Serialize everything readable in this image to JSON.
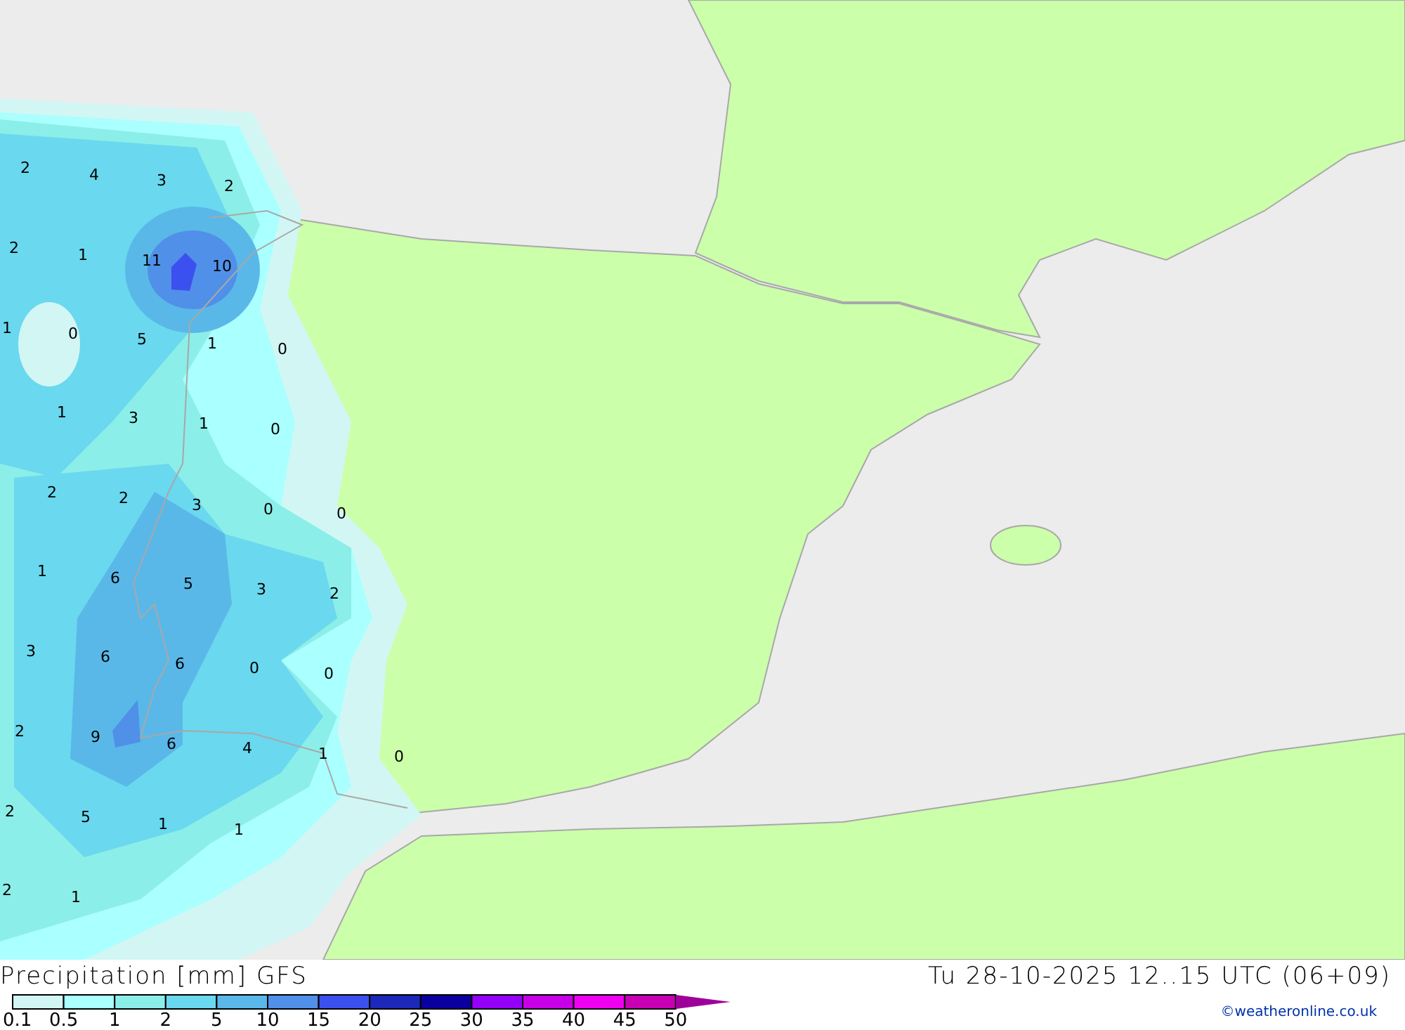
{
  "map": {
    "values": [
      "2",
      "4",
      "3",
      "2",
      "2",
      "1",
      "11",
      "10",
      "1",
      "0",
      "5",
      "1",
      "0",
      "1",
      "3",
      "1",
      "0",
      "2",
      "2",
      "3",
      "0",
      "0",
      "1",
      "6",
      "5",
      "3",
      "2",
      "3",
      "6",
      "6",
      "0",
      "0",
      "2",
      "9",
      "6",
      "4",
      "1",
      "0",
      "2",
      "5",
      "1",
      "1",
      "2",
      "1"
    ]
  },
  "title": "Precipitation [mm] GFS",
  "valid_time": "Tu 28-10-2025 12..15 UTC (06+09)",
  "legend": {
    "bins": [
      {
        "color": "#d2f6f4"
      },
      {
        "color": "#aaffff"
      },
      {
        "color": "#8ceee8"
      },
      {
        "color": "#6ad8ee"
      },
      {
        "color": "#5ab8e8"
      },
      {
        "color": "#5090e8"
      },
      {
        "color": "#3c50f0"
      },
      {
        "color": "#1c28b8"
      },
      {
        "color": "#0a00a0"
      },
      {
        "color": "#9400f8"
      },
      {
        "color": "#c800e8"
      },
      {
        "color": "#f000f0"
      },
      {
        "color": "#c800b4"
      }
    ],
    "labels": [
      "0.1",
      "0.5",
      "1",
      "2",
      "5",
      "10",
      "15",
      "20",
      "25",
      "30",
      "35",
      "40",
      "45",
      "50"
    ]
  },
  "credit": "©weatheronline.co.uk"
}
